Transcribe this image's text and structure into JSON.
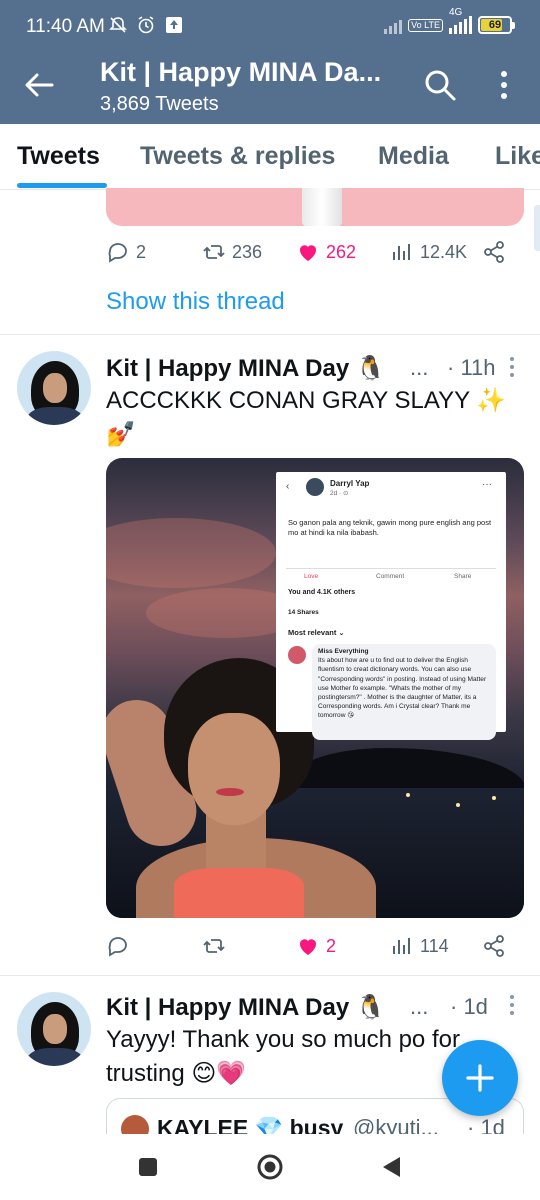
{
  "status_bar": {
    "time": "11:40 AM",
    "network": "4G",
    "lte_label": "Vo LTE",
    "battery": "69"
  },
  "header": {
    "title": "Kit | Happy MINA Da...",
    "subtitle": "3,869 Tweets",
    "icons": [
      "back-arrow-icon",
      "search-icon",
      "more-vertical-icon"
    ]
  },
  "tabs": [
    {
      "label": "Tweets",
      "active": true
    },
    {
      "label": "Tweets & replies",
      "active": false
    },
    {
      "label": "Media",
      "active": false
    },
    {
      "label": "Like",
      "active": false
    }
  ],
  "previous_tweet": {
    "replies": "2",
    "retweets": "236",
    "likes": "262",
    "views": "12.4K",
    "show_thread": "Show this thread"
  },
  "tweets": [
    {
      "name": "Kit | Happy MINA Day 🐧",
      "ellipsis": "...",
      "time": "· 11h",
      "text": "ACCCKKK CONAN GRAY SLAYY ✨💅",
      "replies": "",
      "retweets": "",
      "likes": "2",
      "views": "114",
      "media": {
        "fb_name": "Darryl Yap",
        "fb_time": "2d · ⊙",
        "fb_post": "So ganon pala ang teknik, gawin mong pure english ang post mo at hindi ka nila ibabash.",
        "fb_love": "Love",
        "fb_comment": "Comment",
        "fb_share": "Share",
        "fb_reactions": "You and 4.1K others",
        "fb_shares": "14 Shares",
        "fb_relevant": "Most relevant ⌄",
        "fb_commenter": "Miss Everything",
        "fb_comment_text": "Its about how are u to find out to deliver the English fluentism to creat dictionary words. You can also use \"Corresponding words\" in posting. Instead of using Matter use Mother fo example. \"Whats the mother of my postingtersm?\" . Mother is the daughter of Matter, its a Corresponding words. Am i Crystal clear? Thank me tomorrow 😘"
      }
    },
    {
      "name": "Kit | Happy MINA Day 🐧",
      "ellipsis": "...",
      "time": "· 1d",
      "text": "Yayyy! Thank you so much po for trusting 😊💗",
      "quote": {
        "name": "KAYLEE 💎 busy",
        "handle": "@kyuti...",
        "time": "· 1d"
      }
    }
  ],
  "colors": {
    "header_bg": "#55708f",
    "accent": "#1d9bf0",
    "like": "#f91880",
    "muted": "#536471"
  }
}
